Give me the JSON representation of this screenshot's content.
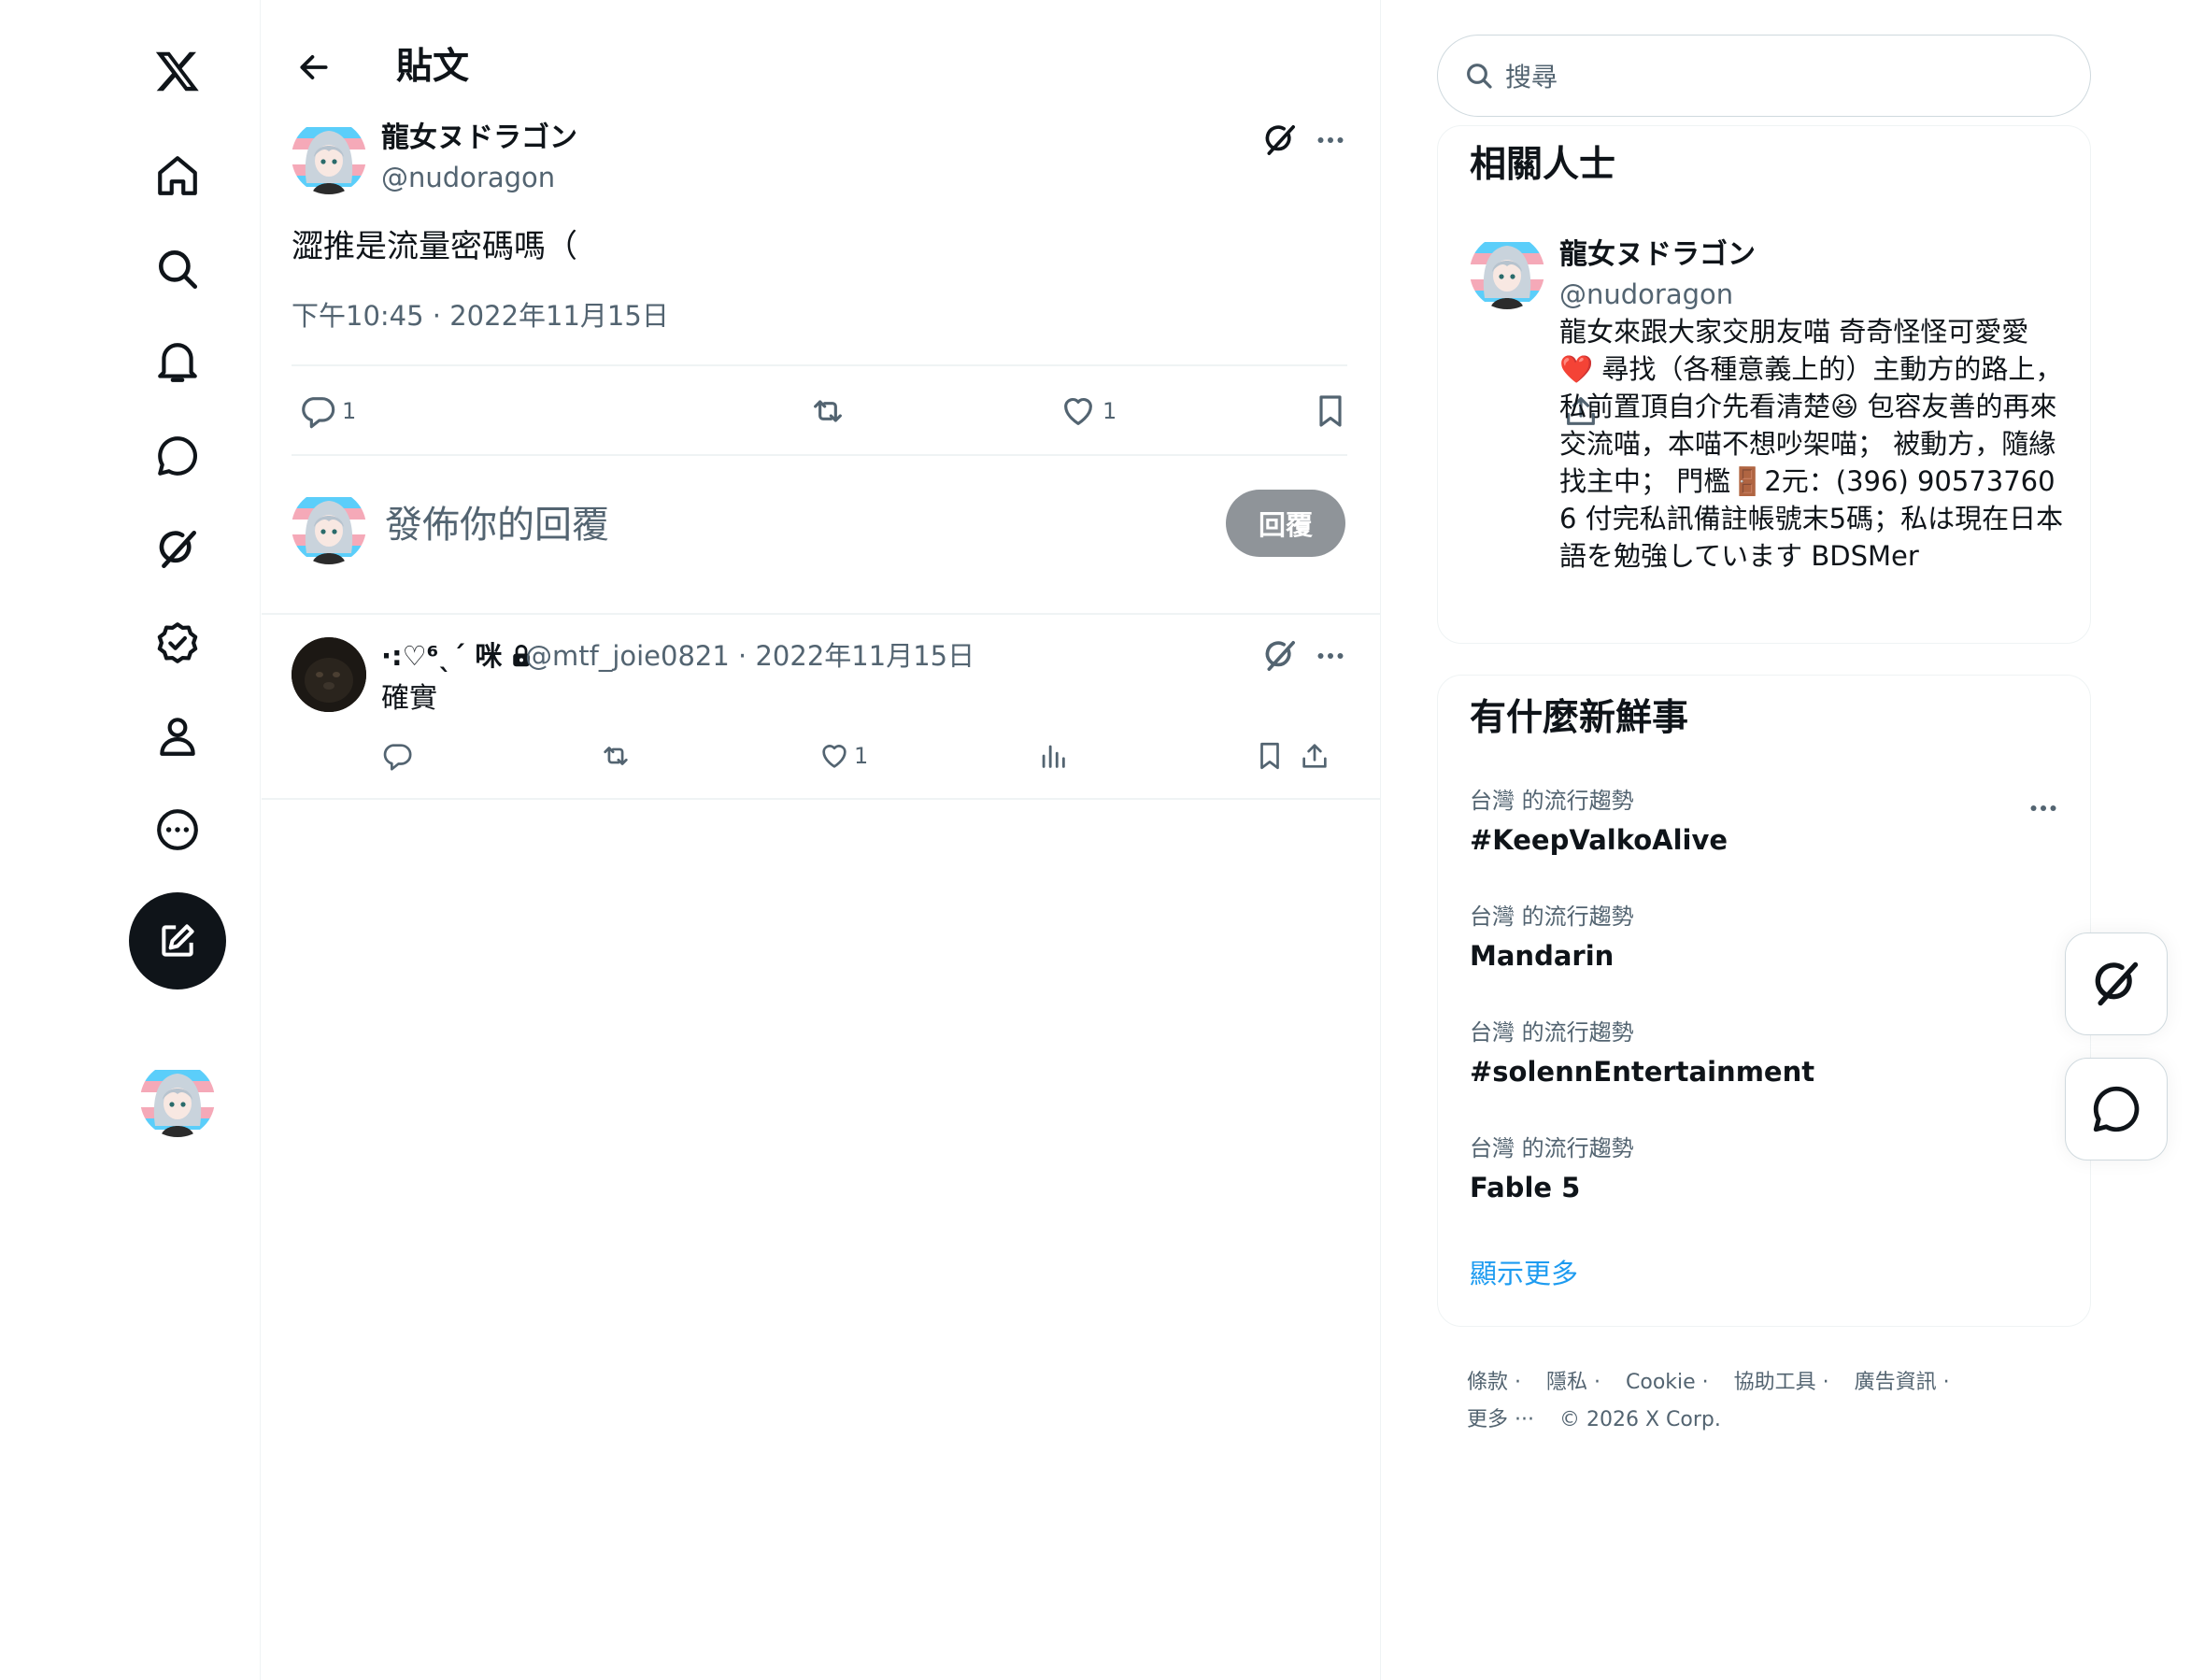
{
  "header": {
    "title": "貼文"
  },
  "post": {
    "author_name": "龍女ヌドラゴン",
    "author_handle": "@nudoragon",
    "text": "澀推是流量密碼嗎（",
    "timestamp": "下午10:45 · 2022年11月15日",
    "reply_count": "1",
    "like_count": "1"
  },
  "reply_box": {
    "placeholder": "發佈你的回覆",
    "button_label": "回覆"
  },
  "comment": {
    "author_name": "·:♡⁶ˎˊ 咪",
    "meta": "@mtf_joie0821 · 2022年11月15日",
    "text": "確實",
    "like_count": "1"
  },
  "search": {
    "placeholder": "搜尋"
  },
  "related": {
    "title": "相關人士",
    "name": "龍女ヌドラゴン",
    "handle": "@nudoragon",
    "bio": "龍女來跟大家交朋友喵 奇奇怪怪可愛愛 ❤️ 尋找（各種意義上的）主動方的路上， 私前置頂自介先看清楚😆 包容友善的再來交流喵，本喵不想吵架喵； 被動方，隨緣找主中； 門檻🚪2元：(396) 905737606 付完私訊備註帳號末5碼；私は現在日本語を勉強しています BDSMer"
  },
  "trends": {
    "title": "有什麼新鮮事",
    "items": [
      {
        "category": "台灣 的流行趨勢",
        "name": "#KeepValkoAlive"
      },
      {
        "category": "台灣 的流行趨勢",
        "name": "Mandarin"
      },
      {
        "category": "台灣 的流行趨勢",
        "name": "#solennEntertainment"
      },
      {
        "category": "台灣 的流行趨勢",
        "name": "Fable 5"
      }
    ],
    "show_more": "顯示更多"
  },
  "footer": {
    "links": [
      "條款 ·",
      "隱私 ·",
      "Cookie ·",
      "協助工具 ·",
      "廣告資訊 ·",
      "更多 ···"
    ],
    "copyright": "© 2026 X Corp."
  },
  "icons": {
    "nav": [
      "x-logo-icon",
      "home-icon",
      "search-icon",
      "bell-icon",
      "message-icon",
      "grok-icon",
      "verified-icon",
      "profile-icon",
      "more-circle-icon"
    ],
    "compose": "compose-icon"
  }
}
